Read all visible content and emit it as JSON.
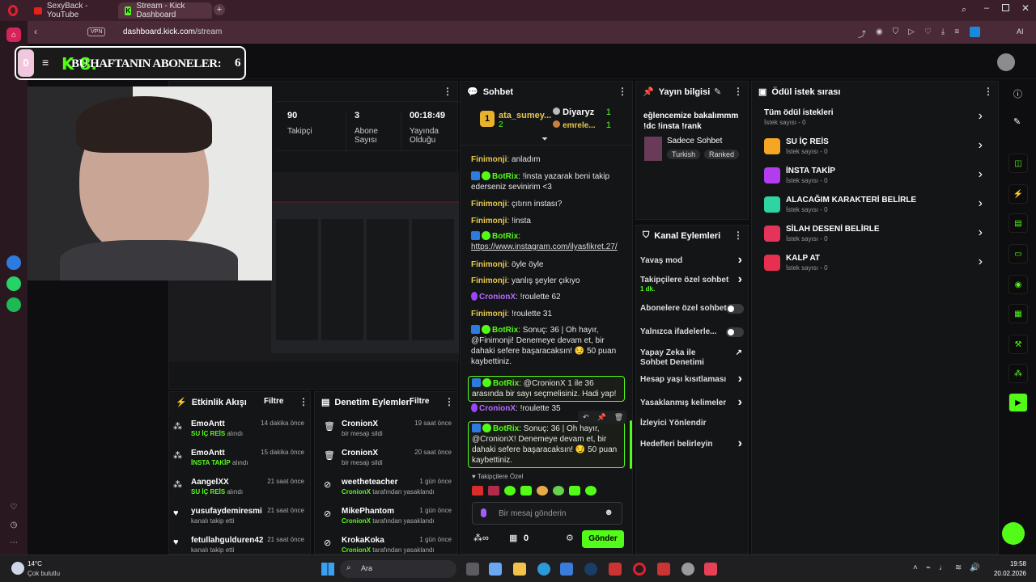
{
  "browser": {
    "tabs": [
      {
        "title": "SexyBack - YouTube"
      },
      {
        "title": "Stream - Kick Dashboard"
      }
    ],
    "url": {
      "host": "dashboard.kick.com",
      "path": "/stream"
    },
    "vpn_label": "VPN",
    "ai_label": "AI"
  },
  "overlay": {
    "title": "BU HAFTANIN ABONELER:",
    "count_left": "0",
    "count_right": "6",
    "logo_text": "K 8."
  },
  "stream_stats": {
    "items": [
      {
        "value": "90",
        "label": "Takipçi"
      },
      {
        "value": "3",
        "label": "Abone Sayısı"
      },
      {
        "value": "00:18:49",
        "label": "Yayında Olduğu"
      }
    ]
  },
  "chat": {
    "title": "Sohbet",
    "top_gifter": {
      "rank": "1",
      "name": "ata_sumey...",
      "count": "2"
    },
    "leaders": [
      {
        "name": "Diyaryz",
        "count": "1"
      },
      {
        "name": "emrele...",
        "count": "1"
      }
    ],
    "messages": [
      {
        "user": "Finimonji",
        "text": "anladım"
      },
      {
        "user": "BotRix",
        "text": "!insta yazarak beni takip ederseniz sevinirim <3"
      },
      {
        "user": "Finimonji",
        "text": "çıtırın instası?"
      },
      {
        "user": "Finimonji",
        "text": "!insta"
      },
      {
        "user": "BotRix",
        "text": "https://www.instagram.com/ilyasfikret.27/"
      },
      {
        "user": "Finimonji",
        "text": "öyle öyle"
      },
      {
        "user": "Finimonji",
        "text": "yanlış şeyler çıkıyo"
      },
      {
        "user": "CronionX",
        "text": "!roulette 62"
      },
      {
        "user": "Finimonji",
        "text": "!roulette 31"
      },
      {
        "user": "BotRix",
        "text": "Sonuç: 36 | Oh hayır, @Finimonji! Denemeye devam et, bir dahaki sefere başaracaksın! 😏 50 puan kaybettiniz."
      },
      {
        "user": "BotRix",
        "text": "@CronionX 1 ile 36 arasında bir sayı seçmelisiniz. Hadi yap!"
      },
      {
        "user": "CronionX",
        "text": "!roulette 35"
      },
      {
        "user": "BotRix",
        "text": "Sonuç: 36 | Oh hayır, @CronionX! Denemeye devam et, bir dahaki sefere başaracaksın! 😏 50 puan kaybettiniz."
      }
    ],
    "mode_label": "Takipçilere Özel",
    "input_placeholder": "Bir mesaj gönderin",
    "points": "0",
    "send_label": "Gönder"
  },
  "stream_info": {
    "title": "Yayın bilgisi",
    "stream_title": "eğlencemize bakalımmm !dc !insta !rank",
    "category": "Sadece Sohbet",
    "tags": [
      "Turkish",
      "Ranked"
    ]
  },
  "channel_actions": {
    "title": "Kanal Eylemleri",
    "items": [
      {
        "label": "Yavaş mod",
        "control": "chevron"
      },
      {
        "label": "Takipçilere özel sohbet",
        "sub": "1 dk.",
        "control": "chevron"
      },
      {
        "label": "Abonelere özel sohbet",
        "control": "toggle"
      },
      {
        "label": "Yalnızca ifadelerle...",
        "control": "toggle"
      },
      {
        "label": "Yapay Zeka ile Sohbet Denetimi",
        "control": "external"
      },
      {
        "label": "Hesap yaşı kısıtlaması",
        "control": "chevron"
      },
      {
        "label": "Yasaklanmış kelimeler",
        "control": "chevron"
      },
      {
        "label": "İzleyici Yönlendir",
        "control": "none"
      },
      {
        "label": "Hedefleri belirleyin",
        "control": "chevron"
      }
    ]
  },
  "rewards": {
    "title": "Ödül istek sırası",
    "all_label": "Tüm ödül istekleri",
    "all_sub": "İstek sayısı - 0",
    "items": [
      {
        "name": "SU İÇ REİS",
        "sub": "İstek sayısı - 0",
        "color": "#f5a623"
      },
      {
        "name": "İNSTA TAKİP",
        "sub": "İstek sayısı - 0",
        "color": "#b33cf0"
      },
      {
        "name": "ALACAĞIM KARAKTERİ BELİRLE",
        "sub": "İstek sayısı - 0",
        "color": "#2ed5a3"
      },
      {
        "name": "SİLAH DESENİ BELİRLE",
        "sub": "İstek sayısı - 0",
        "color": "#e5345a"
      },
      {
        "name": "KALP AT",
        "sub": "İstek sayısı - 0",
        "color": "#e53050"
      }
    ]
  },
  "activity": {
    "title": "Etkinlik Akışı",
    "filter_label": "Filtre",
    "items": [
      {
        "name": "EmoAntt",
        "sub": "SU İÇ REİS",
        "sub_suffix": "alındı",
        "time": "14 dakika önce"
      },
      {
        "name": "EmoAntt",
        "sub": "İNSTA TAKİP",
        "sub_suffix": "alındı",
        "time": "15 dakika önce"
      },
      {
        "name": "AangelXX",
        "sub": "SU İÇ REİS",
        "sub_suffix": "alındı",
        "time": "21 saat önce"
      },
      {
        "name": "yusufaydemiresmi",
        "sub": "",
        "sub_suffix": "kanalı takip etti",
        "time": "21 saat önce"
      },
      {
        "name": "fetullahgulduren42",
        "sub": "",
        "sub_suffix": "kanalı takip etti",
        "time": "21 saat önce"
      }
    ]
  },
  "moderation": {
    "title": "Denetim Eylemleri",
    "filter_label": "Filtre",
    "items": [
      {
        "name": "CronionX",
        "sub": "bir mesajı sildi",
        "time": "19 saat önce",
        "icon": "trash-icon"
      },
      {
        "name": "CronionX",
        "sub": "bir mesajı sildi",
        "time": "20 saat önce",
        "icon": "trash-icon"
      },
      {
        "name": "weetheteacher",
        "sub": "CronionX",
        "sub_suffix": "tarafından yasaklandı",
        "time": "1 gün önce",
        "icon": "ban-icon"
      },
      {
        "name": "MikePhantom",
        "sub": "CronionX",
        "sub_suffix": "tarafından yasaklandı",
        "time": "1 gün önce",
        "icon": "ban-icon"
      },
      {
        "name": "KrokaKoka",
        "sub": "CronionX",
        "sub_suffix": "tarafından yasaklandı",
        "time": "1 gün önce",
        "icon": "ban-icon"
      }
    ]
  },
  "taskbar": {
    "weather_temp": "14°C",
    "weather_desc": "Çok bulutlu",
    "search_label": "Ara",
    "time": "19:58",
    "date": "20.02.2026"
  }
}
